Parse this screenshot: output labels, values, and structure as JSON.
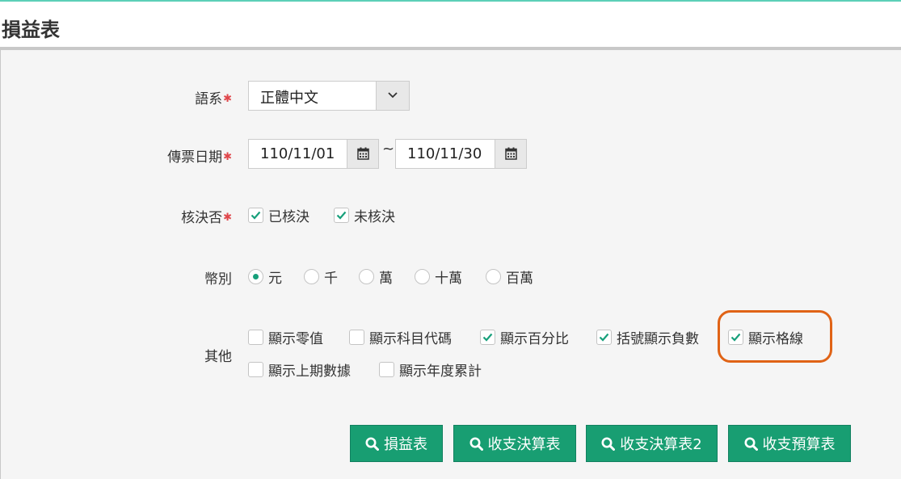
{
  "page": {
    "title": "損益表"
  },
  "form": {
    "language": {
      "label": "語系",
      "required_mark": "✱",
      "value": "正體中文"
    },
    "voucher_date": {
      "label": "傳票日期",
      "required_mark": "✱",
      "start": "110/11/01",
      "separator": "~",
      "end": "110/11/30"
    },
    "approval": {
      "label": "核決否",
      "required_mark": "✱",
      "options": [
        {
          "label": "已核決",
          "checked": true
        },
        {
          "label": "未核決",
          "checked": true
        }
      ]
    },
    "currency_unit": {
      "label": "幣別",
      "options": [
        {
          "label": "元",
          "selected": true
        },
        {
          "label": "千",
          "selected": false
        },
        {
          "label": "萬",
          "selected": false
        },
        {
          "label": "十萬",
          "selected": false
        },
        {
          "label": "百萬",
          "selected": false
        }
      ]
    },
    "other": {
      "label": "其他",
      "options": [
        {
          "label": "顯示零值",
          "checked": false
        },
        {
          "label": "顯示科目代碼",
          "checked": false
        },
        {
          "label": "顯示百分比",
          "checked": true
        },
        {
          "label": "括號顯示負數",
          "checked": true
        },
        {
          "label": "顯示格線",
          "checked": true
        },
        {
          "label": "顯示上期數據",
          "checked": false
        },
        {
          "label": "顯示年度累計",
          "checked": false
        }
      ]
    }
  },
  "actions": [
    {
      "label": "損益表"
    },
    {
      "label": "收支決算表"
    },
    {
      "label": "收支決算表2"
    },
    {
      "label": "收支預算表"
    }
  ],
  "colors": {
    "accent": "#189e72",
    "required": "#e0474c",
    "highlight": "#e06316",
    "check": "#17a07b"
  },
  "icons": {
    "dropdown": "chevron-down-icon",
    "date": "calendar-icon",
    "search": "search-icon",
    "check": "check-icon"
  }
}
